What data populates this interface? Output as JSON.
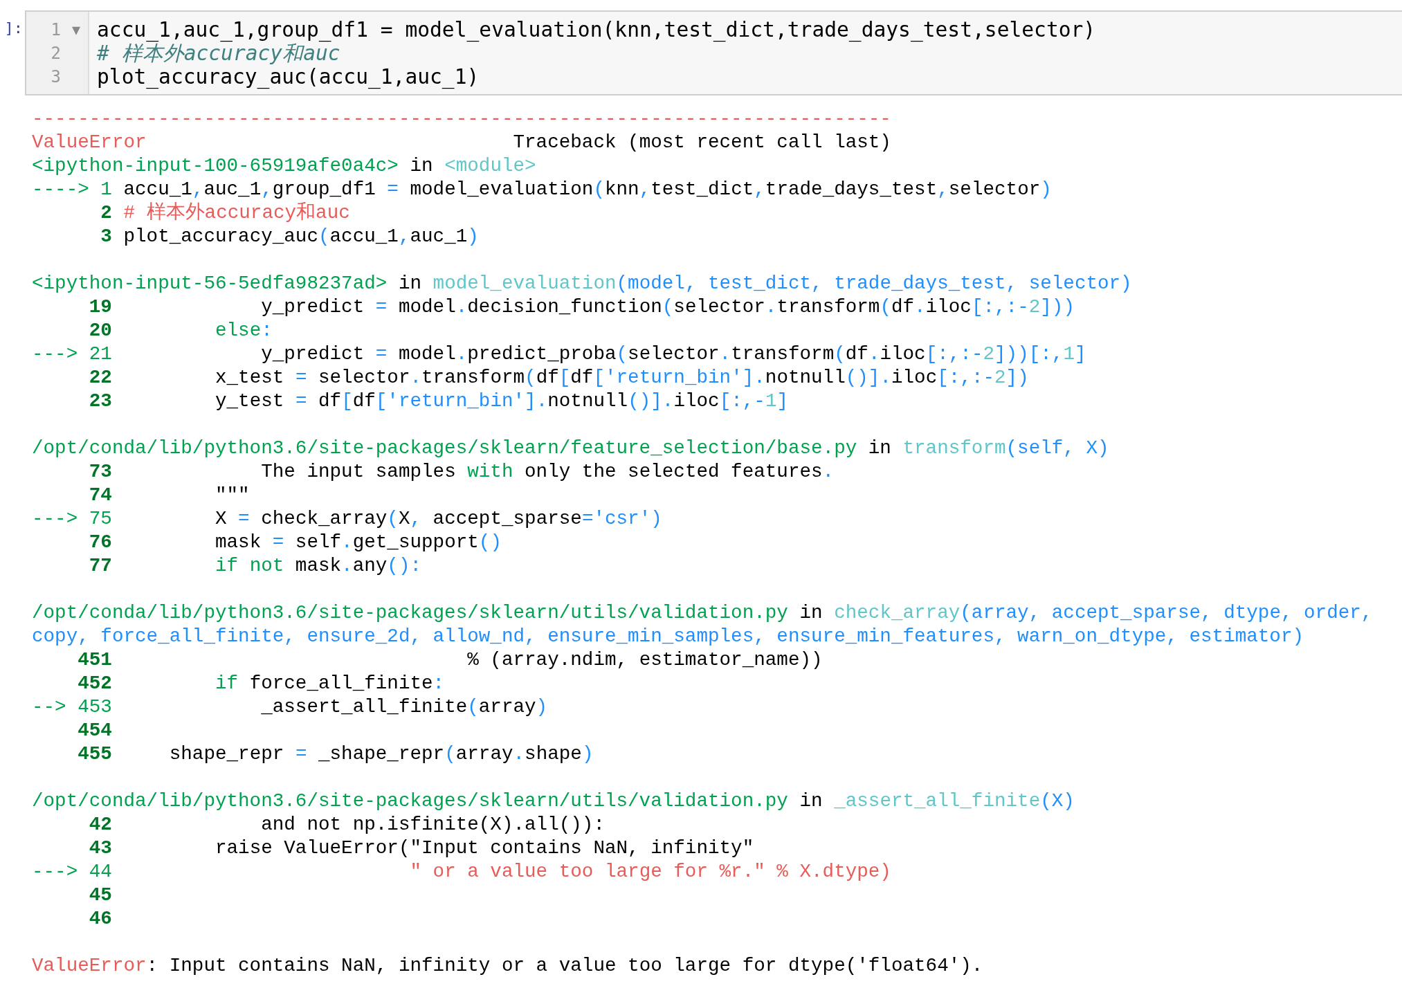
{
  "input_cell": {
    "prompt": "]:",
    "lines": [
      {
        "number": "1",
        "fold": "▼",
        "kind": "code",
        "text": "accu_1,auc_1,group_df1 = model_evaluation(knn,test_dict,trade_days_test,selector)"
      },
      {
        "number": "2",
        "kind": "comment",
        "text": "# 样本外accuracy和auc"
      },
      {
        "number": "3",
        "kind": "code",
        "text": "plot_accuracy_auc(accu_1,auc_1)"
      }
    ]
  },
  "traceback": {
    "blocks": [
      {
        "lines": [
          [
            {
              "kind": "err",
              "text": "---------------------------------------------------------------------------"
            }
          ],
          [
            {
              "kind": "err",
              "text": "ValueError"
            },
            {
              "kind": "plain",
              "text": "                                Traceback (most recent call last)"
            }
          ],
          [
            {
              "kind": "file",
              "text": "<ipython-input-100-65919afe0a4c>"
            },
            {
              "kind": "plain",
              "text": " in "
            },
            {
              "kind": "func",
              "text": "<module>"
            }
          ],
          [
            {
              "kind": "arrow",
              "text": "----> 1 "
            },
            {
              "kind": "plain",
              "text": "accu_1"
            },
            {
              "kind": "op",
              "text": ","
            },
            {
              "kind": "plain",
              "text": "auc_1"
            },
            {
              "kind": "op",
              "text": ","
            },
            {
              "kind": "plain",
              "text": "group_df1 "
            },
            {
              "kind": "op",
              "text": "="
            },
            {
              "kind": "plain",
              "text": " model_evaluation"
            },
            {
              "kind": "op",
              "text": "("
            },
            {
              "kind": "plain",
              "text": "knn"
            },
            {
              "kind": "op",
              "text": ","
            },
            {
              "kind": "plain",
              "text": "test_dict"
            },
            {
              "kind": "op",
              "text": ","
            },
            {
              "kind": "plain",
              "text": "trade_days_test"
            },
            {
              "kind": "op",
              "text": ","
            },
            {
              "kind": "plain",
              "text": "selector"
            },
            {
              "kind": "op",
              "text": ")"
            }
          ],
          [
            {
              "kind": "lineno",
              "text": "      2"
            },
            {
              "kind": "err",
              "text": " # 样本外accuracy和auc"
            }
          ],
          [
            {
              "kind": "lineno",
              "text": "      3"
            },
            {
              "kind": "plain",
              "text": " plot_accuracy_auc"
            },
            {
              "kind": "op",
              "text": "("
            },
            {
              "kind": "plain",
              "text": "accu_1"
            },
            {
              "kind": "op",
              "text": ","
            },
            {
              "kind": "plain",
              "text": "auc_1"
            },
            {
              "kind": "op",
              "text": ")"
            }
          ]
        ]
      },
      {
        "lines": [
          [
            {
              "kind": "file",
              "text": "<ipython-input-56-5edfa98237ad>"
            },
            {
              "kind": "plain",
              "text": " in "
            },
            {
              "kind": "func",
              "text": "model_evaluation"
            },
            {
              "kind": "op",
              "text": "(model, test_dict, trade_days_test, selector)"
            }
          ],
          [
            {
              "kind": "lineno",
              "text": "     19"
            },
            {
              "kind": "plain",
              "text": "             y_predict "
            },
            {
              "kind": "op",
              "text": "="
            },
            {
              "kind": "plain",
              "text": " model"
            },
            {
              "kind": "op",
              "text": "."
            },
            {
              "kind": "plain",
              "text": "decision_function"
            },
            {
              "kind": "op",
              "text": "("
            },
            {
              "kind": "plain",
              "text": "selector"
            },
            {
              "kind": "op",
              "text": "."
            },
            {
              "kind": "plain",
              "text": "transform"
            },
            {
              "kind": "op",
              "text": "("
            },
            {
              "kind": "plain",
              "text": "df"
            },
            {
              "kind": "op",
              "text": "."
            },
            {
              "kind": "plain",
              "text": "iloc"
            },
            {
              "kind": "op",
              "text": "[:,:-"
            },
            {
              "kind": "num",
              "text": "2"
            },
            {
              "kind": "op",
              "text": "]))"
            }
          ],
          [
            {
              "kind": "lineno",
              "text": "     20         "
            },
            {
              "kind": "keyword",
              "text": "else"
            },
            {
              "kind": "op",
              "text": ":"
            }
          ],
          [
            {
              "kind": "arrow",
              "text": "---> 21"
            },
            {
              "kind": "plain",
              "text": "             y_predict "
            },
            {
              "kind": "op",
              "text": "="
            },
            {
              "kind": "plain",
              "text": " model"
            },
            {
              "kind": "op",
              "text": "."
            },
            {
              "kind": "plain",
              "text": "predict_proba"
            },
            {
              "kind": "op",
              "text": "("
            },
            {
              "kind": "plain",
              "text": "selector"
            },
            {
              "kind": "op",
              "text": "."
            },
            {
              "kind": "plain",
              "text": "transform"
            },
            {
              "kind": "op",
              "text": "("
            },
            {
              "kind": "plain",
              "text": "df"
            },
            {
              "kind": "op",
              "text": "."
            },
            {
              "kind": "plain",
              "text": "iloc"
            },
            {
              "kind": "op",
              "text": "[:,:-"
            },
            {
              "kind": "num",
              "text": "2"
            },
            {
              "kind": "op",
              "text": "]))[:,"
            },
            {
              "kind": "num",
              "text": "1"
            },
            {
              "kind": "op",
              "text": "]"
            }
          ],
          [
            {
              "kind": "lineno",
              "text": "     22"
            },
            {
              "kind": "plain",
              "text": "         x_test "
            },
            {
              "kind": "op",
              "text": "="
            },
            {
              "kind": "plain",
              "text": " selector"
            },
            {
              "kind": "op",
              "text": "."
            },
            {
              "kind": "plain",
              "text": "transform"
            },
            {
              "kind": "op",
              "text": "("
            },
            {
              "kind": "plain",
              "text": "df"
            },
            {
              "kind": "op",
              "text": "["
            },
            {
              "kind": "plain",
              "text": "df"
            },
            {
              "kind": "op",
              "text": "['return_bin']."
            },
            {
              "kind": "plain",
              "text": "notnull"
            },
            {
              "kind": "op",
              "text": "()]."
            },
            {
              "kind": "plain",
              "text": "iloc"
            },
            {
              "kind": "op",
              "text": "[:,:-"
            },
            {
              "kind": "num",
              "text": "2"
            },
            {
              "kind": "op",
              "text": "])"
            }
          ],
          [
            {
              "kind": "lineno",
              "text": "     23"
            },
            {
              "kind": "plain",
              "text": "         y_test "
            },
            {
              "kind": "op",
              "text": "="
            },
            {
              "kind": "plain",
              "text": " df"
            },
            {
              "kind": "op",
              "text": "["
            },
            {
              "kind": "plain",
              "text": "df"
            },
            {
              "kind": "op",
              "text": "['return_bin']."
            },
            {
              "kind": "plain",
              "text": "notnull"
            },
            {
              "kind": "op",
              "text": "()]."
            },
            {
              "kind": "plain",
              "text": "iloc"
            },
            {
              "kind": "op",
              "text": "[:,-"
            },
            {
              "kind": "num",
              "text": "1"
            },
            {
              "kind": "op",
              "text": "]"
            }
          ]
        ]
      },
      {
        "lines": [
          [
            {
              "kind": "file",
              "text": "/opt/conda/lib/python3.6/site-packages/sklearn/feature_selection/base.py"
            },
            {
              "kind": "plain",
              "text": " in "
            },
            {
              "kind": "func",
              "text": "transform"
            },
            {
              "kind": "op",
              "text": "(self, X)"
            }
          ],
          [
            {
              "kind": "lineno",
              "text": "     73"
            },
            {
              "kind": "plain",
              "text": "             The input samples "
            },
            {
              "kind": "keyword",
              "text": "with"
            },
            {
              "kind": "plain",
              "text": " only the selected features"
            },
            {
              "kind": "op",
              "text": "."
            }
          ],
          [
            {
              "kind": "lineno",
              "text": "     74"
            },
            {
              "kind": "plain",
              "text": "         \"\"\""
            }
          ],
          [
            {
              "kind": "arrow",
              "text": "---> 75"
            },
            {
              "kind": "plain",
              "text": "         X "
            },
            {
              "kind": "op",
              "text": "="
            },
            {
              "kind": "plain",
              "text": " check_array"
            },
            {
              "kind": "op",
              "text": "("
            },
            {
              "kind": "plain",
              "text": "X"
            },
            {
              "kind": "op",
              "text": ","
            },
            {
              "kind": "plain",
              "text": " accept_sparse"
            },
            {
              "kind": "op",
              "text": "='csr')"
            }
          ],
          [
            {
              "kind": "lineno",
              "text": "     76"
            },
            {
              "kind": "plain",
              "text": "         mask "
            },
            {
              "kind": "op",
              "text": "="
            },
            {
              "kind": "plain",
              "text": " self"
            },
            {
              "kind": "op",
              "text": "."
            },
            {
              "kind": "plain",
              "text": "get_support"
            },
            {
              "kind": "op",
              "text": "()"
            }
          ],
          [
            {
              "kind": "lineno",
              "text": "     77         "
            },
            {
              "kind": "keyword",
              "text": "if not"
            },
            {
              "kind": "plain",
              "text": " mask"
            },
            {
              "kind": "op",
              "text": "."
            },
            {
              "kind": "plain",
              "text": "any"
            },
            {
              "kind": "op",
              "text": "():"
            }
          ]
        ]
      },
      {
        "lines": [
          [
            {
              "kind": "file",
              "text": "/opt/conda/lib/python3.6/site-packages/sklearn/utils/validation.py"
            },
            {
              "kind": "plain",
              "text": " in "
            },
            {
              "kind": "func",
              "text": "check_array"
            },
            {
              "kind": "op",
              "text": "(array, accept_sparse, dtype, order,"
            }
          ],
          [
            {
              "kind": "op",
              "text": "copy, force_all_finite, ensure_2d, allow_nd, ensure_min_samples, ensure_min_features, warn_on_dtype, estimator)"
            }
          ],
          [
            {
              "kind": "lineno",
              "text": "    451"
            },
            {
              "kind": "plain",
              "text": "                               % (array.ndim, estimator_name))"
            }
          ],
          [
            {
              "kind": "lineno",
              "text": "    452         "
            },
            {
              "kind": "keyword",
              "text": "if"
            },
            {
              "kind": "plain",
              "text": " force_all_finite"
            },
            {
              "kind": "op",
              "text": ":"
            }
          ],
          [
            {
              "kind": "arrow",
              "text": "--> 453"
            },
            {
              "kind": "plain",
              "text": "             _assert_all_finite"
            },
            {
              "kind": "op",
              "text": "("
            },
            {
              "kind": "plain",
              "text": "array"
            },
            {
              "kind": "op",
              "text": ")"
            }
          ],
          [
            {
              "kind": "lineno",
              "text": "    454"
            }
          ],
          [
            {
              "kind": "lineno",
              "text": "    455"
            },
            {
              "kind": "plain",
              "text": "     shape_repr "
            },
            {
              "kind": "op",
              "text": "="
            },
            {
              "kind": "plain",
              "text": " _shape_repr"
            },
            {
              "kind": "op",
              "text": "("
            },
            {
              "kind": "plain",
              "text": "array"
            },
            {
              "kind": "op",
              "text": "."
            },
            {
              "kind": "plain",
              "text": "shape"
            },
            {
              "kind": "op",
              "text": ")"
            }
          ]
        ]
      },
      {
        "lines": [
          [
            {
              "kind": "file",
              "text": "/opt/conda/lib/python3.6/site-packages/sklearn/utils/validation.py"
            },
            {
              "kind": "plain",
              "text": " in "
            },
            {
              "kind": "func",
              "text": "_assert_all_finite"
            },
            {
              "kind": "op",
              "text": "(X)"
            }
          ],
          [
            {
              "kind": "lineno",
              "text": "     42"
            },
            {
              "kind": "plain",
              "text": "             and not np.isfinite(X).all()):"
            }
          ],
          [
            {
              "kind": "lineno",
              "text": "     43"
            },
            {
              "kind": "plain",
              "text": "         raise ValueError(\"Input contains NaN, infinity\""
            }
          ],
          [
            {
              "kind": "arrow",
              "text": "---> 44"
            },
            {
              "kind": "err",
              "text": "                          \" or a value too large for %r.\" % X.dtype)"
            }
          ],
          [
            {
              "kind": "lineno",
              "text": "     45"
            }
          ],
          [
            {
              "kind": "lineno",
              "text": "     46"
            }
          ]
        ]
      },
      {
        "lines": [
          [
            {
              "kind": "err",
              "text": "ValueError"
            },
            {
              "kind": "plain",
              "text": ": Input contains NaN, infinity or a value too large for dtype('float64')."
            }
          ]
        ]
      }
    ]
  }
}
